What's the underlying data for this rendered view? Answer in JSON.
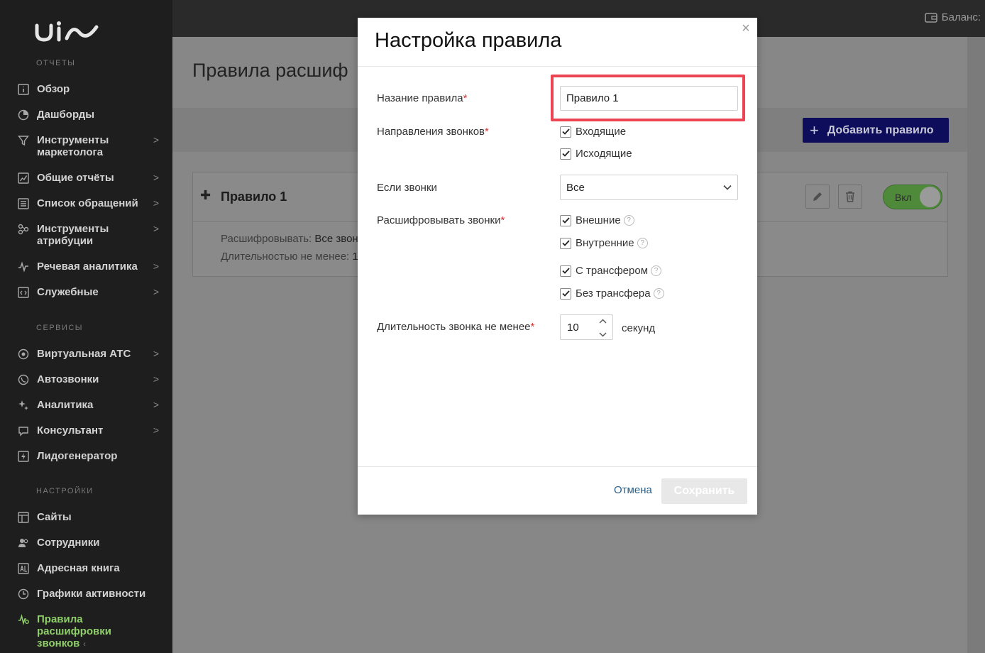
{
  "sidebar": {
    "sections": {
      "reports": "ОТЧЕТЫ",
      "services": "СЕРВИСЫ",
      "settings": "НАСТРОЙКИ"
    },
    "items": [
      {
        "label": "Обзор",
        "icon": "info-icon",
        "chevron": ""
      },
      {
        "label": "Дашборды",
        "icon": "pie-chart-icon",
        "chevron": ""
      },
      {
        "label": "Инструменты маркетолога",
        "icon": "funnel-icon",
        "chevron": ">"
      },
      {
        "label": "Общие отчёты",
        "icon": "chart-icon",
        "chevron": ">"
      },
      {
        "label": "Список обращений",
        "icon": "list-icon",
        "chevron": ">"
      },
      {
        "label": "Инструменты атрибуции",
        "icon": "attribution-icon",
        "chevron": ">"
      },
      {
        "label": "Речевая аналитика",
        "icon": "waveform-icon",
        "chevron": ">"
      },
      {
        "label": "Служебные",
        "icon": "code-icon",
        "chevron": ">"
      },
      {
        "label": "Виртуальная АТС",
        "icon": "pbx-icon",
        "chevron": ">"
      },
      {
        "label": "Автозвонки",
        "icon": "phone-icon",
        "chevron": ">"
      },
      {
        "label": "Аналитика",
        "icon": "sparkle-icon",
        "chevron": ">"
      },
      {
        "label": "Консультант",
        "icon": "chat-icon",
        "chevron": ">"
      },
      {
        "label": "Лидогенератор",
        "icon": "lightning-icon",
        "chevron": ""
      },
      {
        "label": "Сайты",
        "icon": "sites-icon",
        "chevron": ""
      },
      {
        "label": "Сотрудники",
        "icon": "users-icon",
        "chevron": ""
      },
      {
        "label": "Адресная книга",
        "icon": "address-book-icon",
        "chevron": ""
      },
      {
        "label": "Графики активности",
        "icon": "clock-icon",
        "chevron": ""
      },
      {
        "label": "Правила расшифровки звонков",
        "icon": "rules-icon",
        "chevron": ""
      }
    ],
    "collapse": "‹"
  },
  "topbar": {
    "balance_label": "Баланс:"
  },
  "page": {
    "title": "Правила расшиф",
    "add_button": "Добавить правило",
    "rule": {
      "name": "Правило 1",
      "line1_label": "Расшифровывать:",
      "line1_value": "Все звон",
      "line2_label": "Длительностью не менее:",
      "line2_value": "1",
      "toggle": "Вкл"
    }
  },
  "modal": {
    "title": "Настройка правила",
    "close": "×",
    "name_label": "Назание правила",
    "name_value": "Правило 1",
    "directions_label": "Направления звонков",
    "directions": [
      "Входящие",
      "Исходящие"
    ],
    "if_calls_label": "Если звонки",
    "if_calls_value": "Все",
    "decode_label": "Расшифровывать звонки",
    "decode_options": [
      "Внешние",
      "Внутренние",
      "С трансфером",
      "Без трансфера"
    ],
    "duration_label": "Длительность звонка не менее",
    "duration_value": "10",
    "duration_unit": "секунд",
    "required_mark": "*",
    "help_mark": "?",
    "cancel": "Отмена",
    "save": "Сохранить"
  },
  "colors": {
    "sidebar_bg": "#1e1e1e",
    "active_green": "#8fcf6a",
    "highlight_red": "#ec4452",
    "add_button_bg": "#0d0d5c",
    "link_blue": "#2a5d86"
  }
}
